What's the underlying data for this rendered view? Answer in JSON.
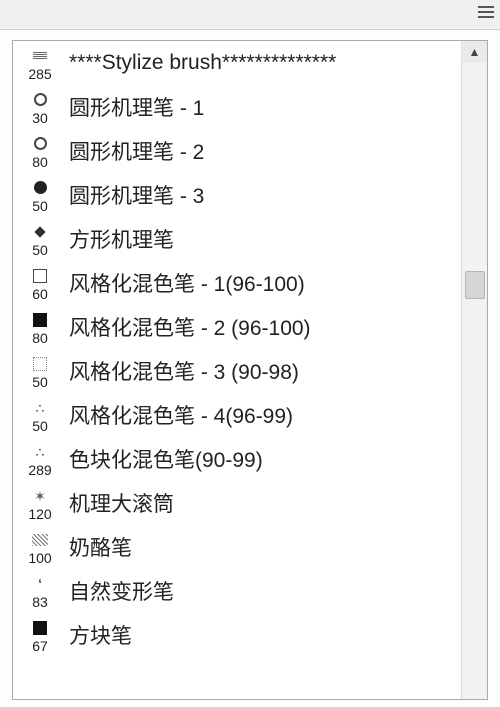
{
  "brushes": [
    {
      "size": "285",
      "label": "****Stylize brush**************",
      "icon": "lines"
    },
    {
      "size": "30",
      "label": "圆形机理笔 - 1",
      "icon": "circle-open"
    },
    {
      "size": "80",
      "label": "圆形机理笔 - 2",
      "icon": "circle-open"
    },
    {
      "size": "50",
      "label": "圆形机理笔 - 3",
      "icon": "circle-solid"
    },
    {
      "size": "50",
      "label": "方形机理笔",
      "icon": "diamond"
    },
    {
      "size": "60",
      "label": "风格化混色笔 - 1(96-100)",
      "icon": "square-open"
    },
    {
      "size": "80",
      "label": "风格化混色笔 - 2 (96-100)",
      "icon": "square-solid"
    },
    {
      "size": "50",
      "label": "风格化混色笔 - 3 (90-98)",
      "icon": "square-soft"
    },
    {
      "size": "50",
      "label": "风格化混色笔 - 4(96-99)",
      "icon": "spray"
    },
    {
      "size": "289",
      "label": "色块化混色笔(90-99)",
      "icon": "spray"
    },
    {
      "size": "120",
      "label": "机理大滚筒",
      "icon": "star"
    },
    {
      "size": "100",
      "label": "奶酪笔",
      "icon": "noise"
    },
    {
      "size": "83",
      "label": "自然变形笔",
      "icon": "drop"
    },
    {
      "size": "67",
      "label": "方块笔",
      "icon": "square-solid"
    }
  ],
  "scroll": {
    "up": "▲",
    "down": "▼"
  }
}
